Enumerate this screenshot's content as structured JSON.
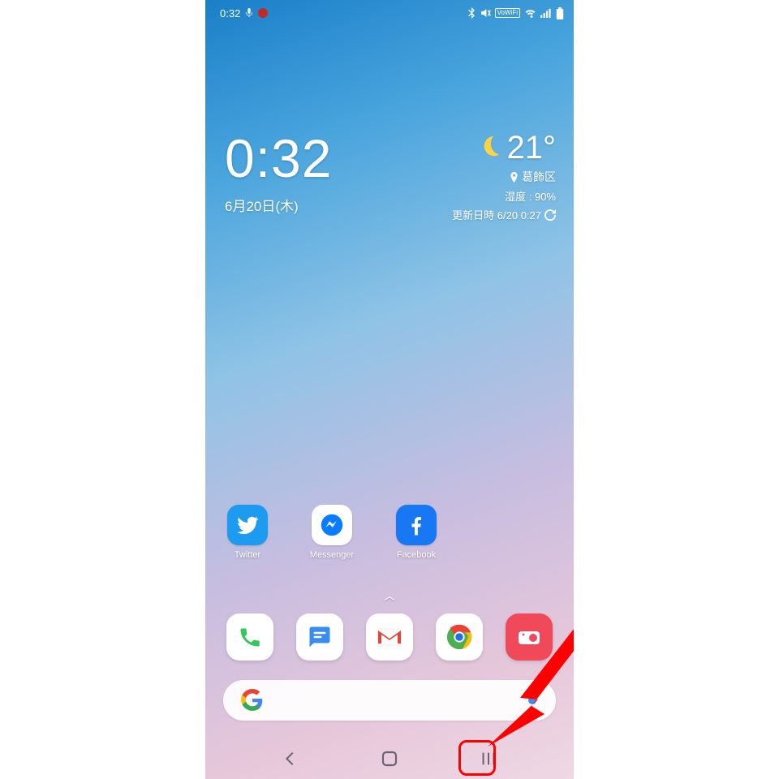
{
  "status": {
    "time": "0:32",
    "icons": {
      "mic": "mic-icon",
      "app": "app-dot-icon",
      "bluetooth": "bluetooth-icon",
      "mute": "mute-icon",
      "vowifi": "VoWiFi",
      "wifi": "wifi-icon",
      "signal": "signal-icon",
      "battery": "battery-icon"
    }
  },
  "clock": {
    "time": "0:32",
    "date": "6月20日(木)"
  },
  "weather": {
    "temp": "21°",
    "location": "葛飾区",
    "humidity_label": "湿度 : 90%",
    "updated_label": "更新日時 6/20 0:27"
  },
  "apps": {
    "row": [
      {
        "label": "Twitter"
      },
      {
        "label": "Messenger"
      },
      {
        "label": "Facebook"
      }
    ]
  },
  "dock": {
    "items": [
      "Phone",
      "Messages",
      "Gmail",
      "Chrome",
      "Camera"
    ]
  },
  "search": {
    "provider": "Google"
  },
  "nav": {
    "back": "Back",
    "home": "Home",
    "recents": "Recents"
  },
  "annotation": {
    "highlight": "recents-button"
  }
}
